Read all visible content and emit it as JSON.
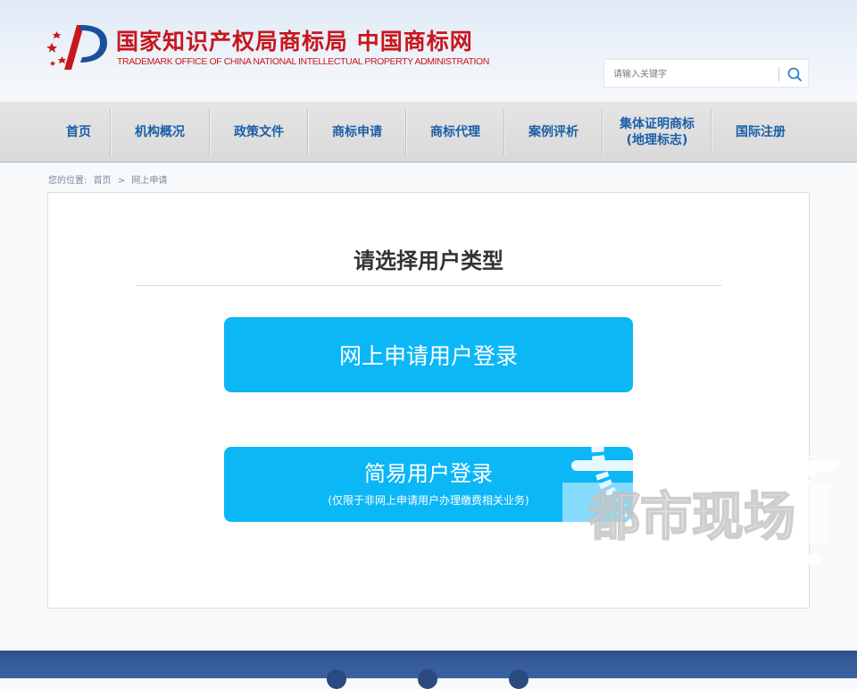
{
  "header": {
    "title_cn": "国家知识产权局商标局 中国商标网",
    "title_en": "TRADEMARK OFFICE OF CHINA NATIONAL INTELLECTUAL PROPERTY ADMINISTRATION",
    "logo_icon": "cnipa-logo-icon",
    "brand_color": "#c8161d"
  },
  "search": {
    "placeholder": "请输入关键字",
    "icon": "search-icon"
  },
  "nav": {
    "items": [
      {
        "label": "首页"
      },
      {
        "label": "机构概况"
      },
      {
        "label": "政策文件"
      },
      {
        "label": "商标申请"
      },
      {
        "label": "商标代理"
      },
      {
        "label": "案例评析"
      },
      {
        "label": "集体证明商标",
        "label2": "(地理标志)"
      },
      {
        "label": "国际注册"
      }
    ],
    "color": "#1b5fa8"
  },
  "breadcrumb": {
    "prefix": "您的位置:",
    "home": "首页",
    "separator": ">",
    "current": "网上申请"
  },
  "main": {
    "title": "请选择用户类型",
    "online_login_label": "网上申请用户登录",
    "simple_login_label": "简易用户登录",
    "simple_login_note": "(仅限于非网上申请用户办理缴费相关业务)",
    "button_color": "#0cb7f6"
  },
  "watermark": {
    "text": "都市现场",
    "icon": "tv-station-watermark-icon"
  },
  "footer": {
    "color": "#3a63a4"
  }
}
